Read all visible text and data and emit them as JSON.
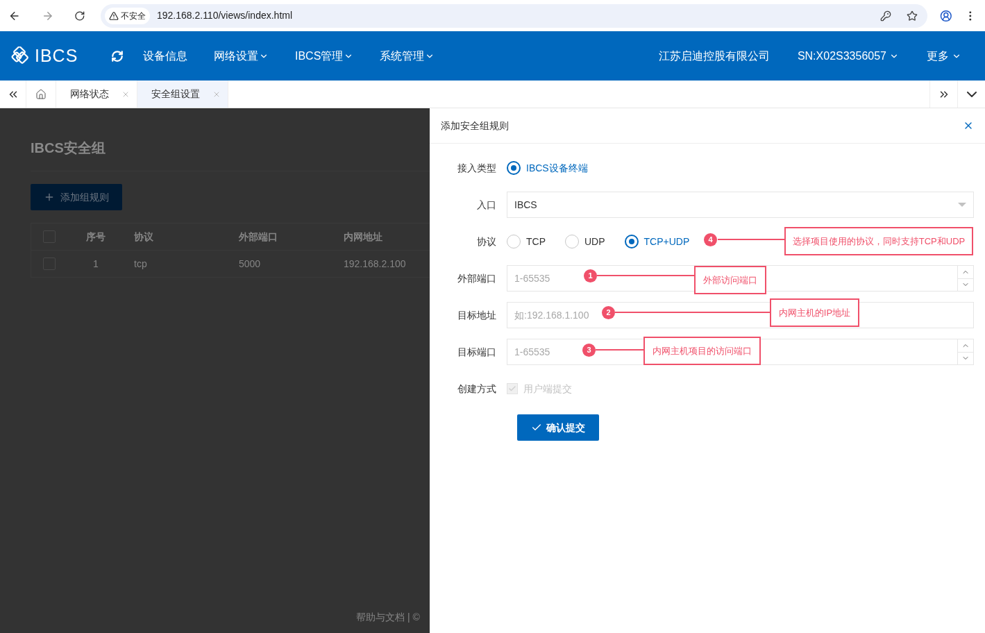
{
  "browser": {
    "security": "不安全",
    "url": "192.168.2.110/views/index.html"
  },
  "header": {
    "logo": "IBCS",
    "nav": [
      {
        "label": "设备信息",
        "dropdown": false
      },
      {
        "label": "网络设置",
        "dropdown": true
      },
      {
        "label": "IBCS管理",
        "dropdown": true
      },
      {
        "label": "系统管理",
        "dropdown": true
      }
    ],
    "right": [
      {
        "label": "江苏启迪控股有限公司",
        "dropdown": false
      },
      {
        "label": "SN:X02S3356057",
        "dropdown": true
      },
      {
        "label": "更多",
        "dropdown": true
      }
    ]
  },
  "tabs": [
    {
      "label": "网络状态",
      "selected": false
    },
    {
      "label": "安全组设置",
      "selected": true
    }
  ],
  "page": {
    "title": "IBCS安全组",
    "add_button": "添加组规则",
    "table": {
      "select_all_checked": false,
      "columns": [
        "序号",
        "协议",
        "外部端口",
        "内网地址"
      ],
      "rows": [
        {
          "checked": false,
          "cells": [
            "1",
            "tcp",
            "5000",
            "192.168.2.100"
          ]
        }
      ]
    },
    "footer": "帮助与文档 | ©"
  },
  "drawer": {
    "title": "添加安全组规则",
    "fields": [
      {
        "kind": "radio",
        "label": "接入类型",
        "options": [
          {
            "label": "IBCS设备终端",
            "selected": true
          }
        ]
      },
      {
        "kind": "select",
        "label": "入口",
        "value": "IBCS"
      },
      {
        "kind": "radio",
        "label": "协议",
        "options": [
          {
            "label": "TCP",
            "selected": false
          },
          {
            "label": "UDP",
            "selected": false
          },
          {
            "label": "TCP+UDP",
            "selected": true
          }
        ]
      },
      {
        "kind": "number",
        "label": "外部端口",
        "placeholder": "1-65535"
      },
      {
        "kind": "text",
        "label": "目标地址",
        "placeholder": "如:192.168.1.100"
      },
      {
        "kind": "number",
        "label": "目标端口",
        "placeholder": "1-65535"
      },
      {
        "kind": "checkbox",
        "label": "创建方式",
        "option": "用户端提交",
        "checked": true,
        "disabled": true
      }
    ],
    "submit": "确认提交"
  },
  "annotations": [
    {
      "number": "4",
      "text": "选择项目使用的协议，同时支持TCP和UDP"
    },
    {
      "number": "1",
      "text": "外部访问端口"
    },
    {
      "number": "2",
      "text": "内网主机的IP地址"
    },
    {
      "number": "3",
      "text": "内网主机项目的访问端口"
    }
  ]
}
